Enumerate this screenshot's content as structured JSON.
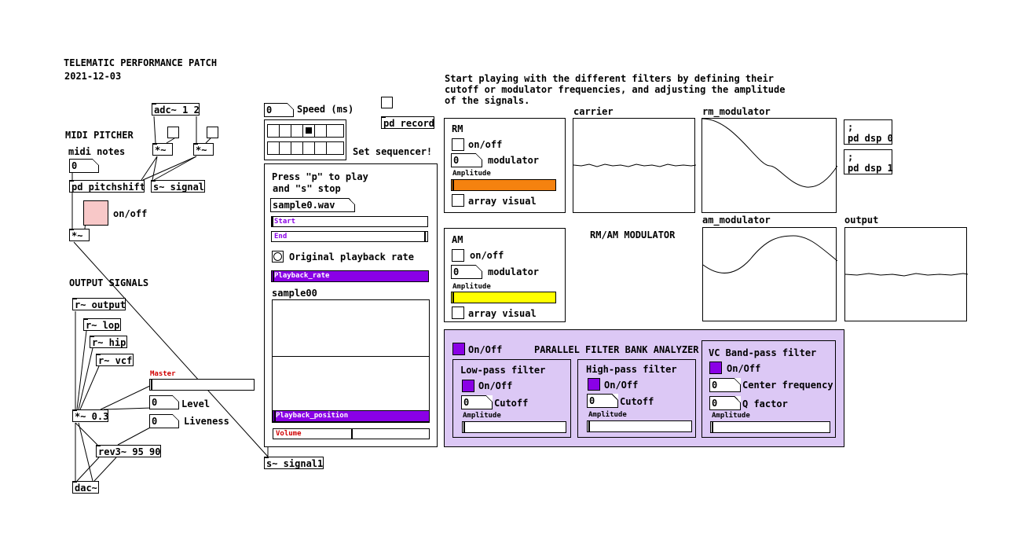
{
  "header": {
    "title": "TELEMATIC PERFORMANCE PATCH",
    "date": "2021-12-03"
  },
  "midi": {
    "section": "MIDI PITCHER",
    "notes_label": "midi notes",
    "notes_value": "0",
    "adc": "adc~ 1 2",
    "mult1": "*~",
    "mult2": "*~",
    "pitchshift": "pd pitchshift",
    "signal": "s~ signal",
    "onoff": "on/off",
    "mult3": "*~"
  },
  "output": {
    "section": "OUTPUT SIGNALS",
    "r_output": "r~ output",
    "r_lop": "r~ lop",
    "r_hip": "r~ hip",
    "r_vcf": "r~ vcf",
    "master": "Master",
    "level_label": "Level",
    "level_value": "0",
    "liveness_label": "Liveness",
    "liveness_value": "0",
    "mult": "*~ 0.3",
    "rev": "rev3~ 95 90",
    "dac": "dac~"
  },
  "sequencer": {
    "speed_value": "0",
    "speed_label": "Speed (ms)",
    "set_label": "Set sequencer!",
    "record": "pd record"
  },
  "sampler": {
    "instructions_1": "Press \"p\" to play",
    "instructions_2": "and \"s\" stop",
    "file": "sample0.wav",
    "start": "Start",
    "end": "End",
    "original_rate": "Original playback rate",
    "playback_rate": "Playback_rate",
    "array_name": "sample00",
    "playback_position": "Playback_position",
    "volume": "Volume",
    "send": "s~ signal1"
  },
  "filters": {
    "intro_1": "Start playing with the different filters by defining their",
    "intro_2": "cutoff or modulator frequencies, and adjusting the amplitude",
    "intro_3": "of the signals."
  },
  "rm": {
    "title": "RM",
    "onoff": "on/off",
    "mod_value": "0",
    "mod_label": "modulator",
    "amp_label": "Amplitude",
    "array_visual": "array visual",
    "amp_color": "#f5820f"
  },
  "am": {
    "title": "AM",
    "onoff": "on/off",
    "mod_value": "0",
    "mod_label": "modulator",
    "amp_label": "Amplitude",
    "array_visual": "array visual",
    "amp_color": "#ffff00"
  },
  "arrays": {
    "carrier": "carrier",
    "rm_modulator": "rm_modulator",
    "am_modulator": "am_modulator",
    "output": "output",
    "rmam_label": "RM/AM MODULATOR"
  },
  "dsp": {
    "on": ";\npd dsp 0",
    "off": ";\npd dsp 1"
  },
  "bank": {
    "onoff": "On/Off",
    "title": "PARALLEL FILTER BANK ANALYZER",
    "bg_color": "#dcc8f5",
    "lowpass": {
      "title": "Low-pass filter",
      "onoff": "On/Off",
      "value": "0",
      "label": "Cutoff",
      "amp": "Amplitude"
    },
    "highpass": {
      "title": "High-pass filter",
      "onoff": "On/Off",
      "value": "0",
      "label": "Cutoff",
      "amp": "Amplitude"
    },
    "bandpass": {
      "title": "VC Band-pass filter",
      "onoff": "On/Off",
      "center_value": "0",
      "center_label": "Center frequency",
      "q_value": "0",
      "q_label": "Q factor",
      "amp": "Amplitude"
    }
  }
}
